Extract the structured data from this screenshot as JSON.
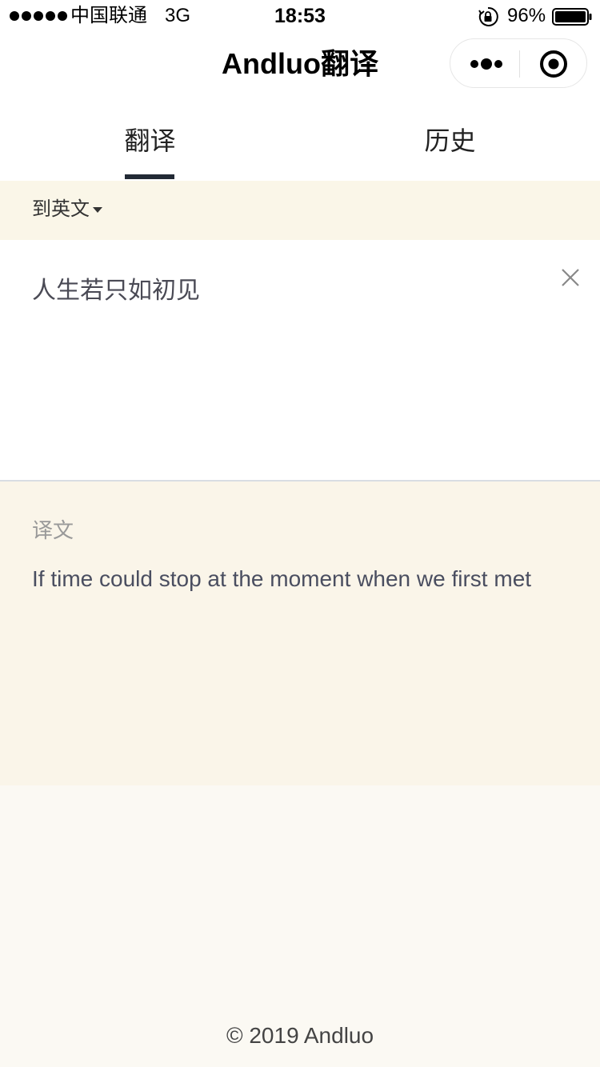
{
  "status_bar": {
    "carrier": "中国联通",
    "network": "3G",
    "time": "18:53",
    "battery_percent": "96%"
  },
  "nav": {
    "title": "Andluo翻译"
  },
  "tabs": [
    {
      "label": "翻译",
      "active": true
    },
    {
      "label": "历史",
      "active": false
    }
  ],
  "language": {
    "selected": "到英文"
  },
  "input": {
    "value": "人生若只如初见"
  },
  "result": {
    "label": "译文",
    "text": "If time could stop at the moment when we first met"
  },
  "footer": {
    "text": "© 2019 Andluo"
  },
  "colors": {
    "accent": "#222a35",
    "lang_bar_bg": "#faf6e8",
    "result_bg": "#faf5e9",
    "page_bg": "#fbf9f3"
  }
}
